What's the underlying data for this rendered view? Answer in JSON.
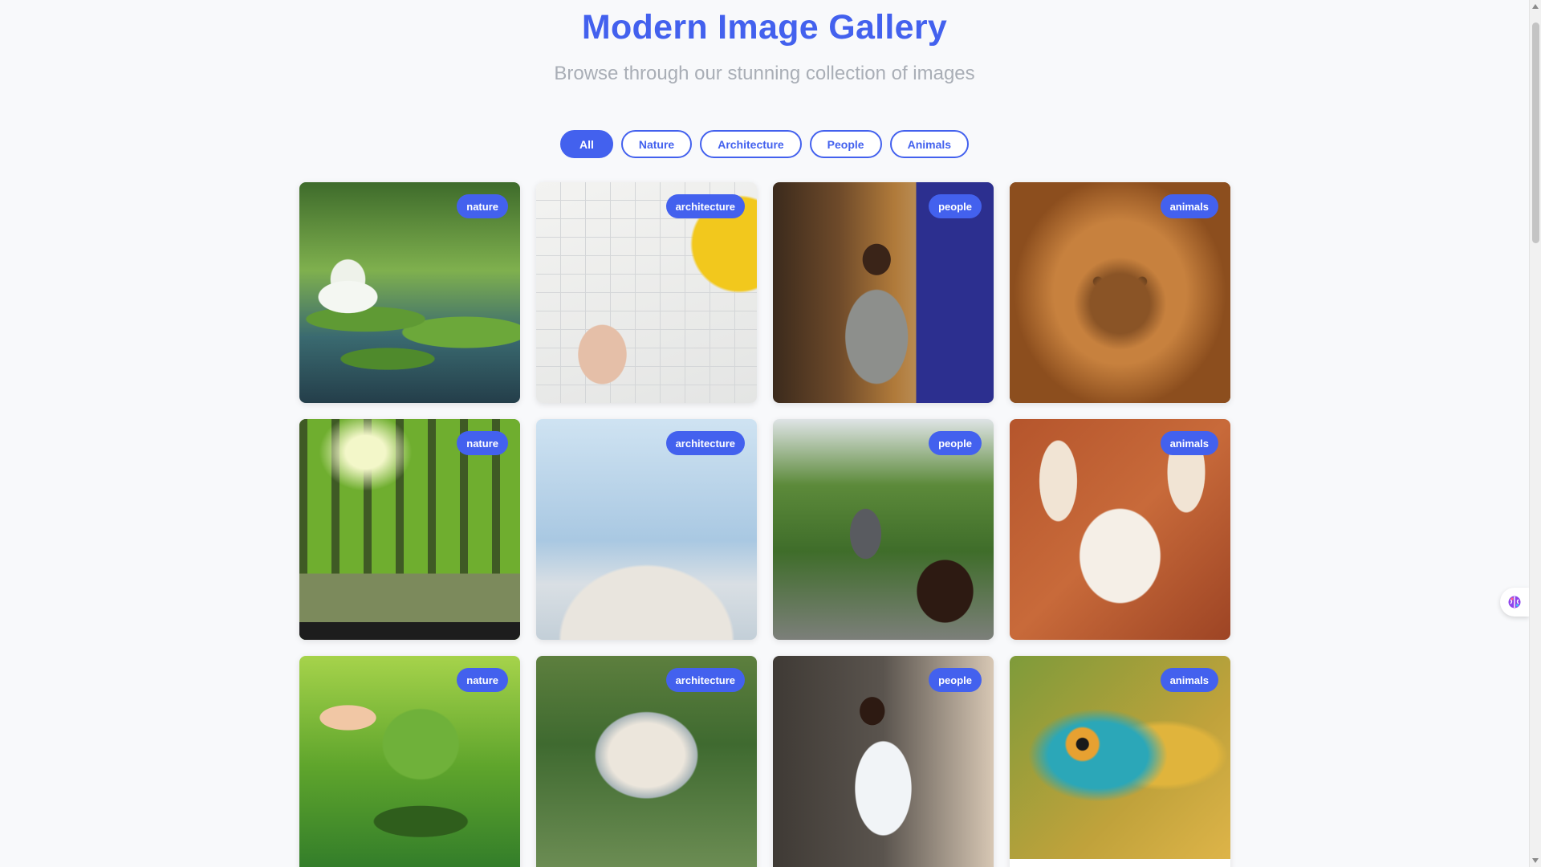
{
  "header": {
    "title": "Modern Image Gallery",
    "subtitle": "Browse through our stunning collection of images"
  },
  "filters": [
    {
      "label": "All",
      "active": true
    },
    {
      "label": "Nature",
      "active": false
    },
    {
      "label": "Architecture",
      "active": false
    },
    {
      "label": "People",
      "active": false
    },
    {
      "label": "Animals",
      "active": false
    }
  ],
  "gallery": [
    {
      "category": "nature",
      "image": "water-lily-photo"
    },
    {
      "category": "architecture",
      "image": "blueprint-photo"
    },
    {
      "category": "people",
      "image": "man-at-exhibition-photo"
    },
    {
      "category": "animals",
      "image": "lion-photo"
    },
    {
      "category": "nature",
      "image": "forest-path-photo"
    },
    {
      "category": "architecture",
      "image": "curved-building-photo"
    },
    {
      "category": "people",
      "image": "group-selfie-photo"
    },
    {
      "category": "animals",
      "image": "fennec-fox-photo"
    },
    {
      "category": "nature",
      "image": "hand-watering-tree-photo"
    },
    {
      "category": "architecture",
      "image": "dome-building-photo"
    },
    {
      "category": "people",
      "image": "smiling-boy-photo"
    },
    {
      "category": "animals",
      "image": "chameleon-photo"
    }
  ],
  "colors": {
    "accent": "#4361ee",
    "background": "#f8f9fb",
    "subtitle": "#a9aeb6"
  },
  "widget": {
    "icon": "brain-extension-icon"
  }
}
